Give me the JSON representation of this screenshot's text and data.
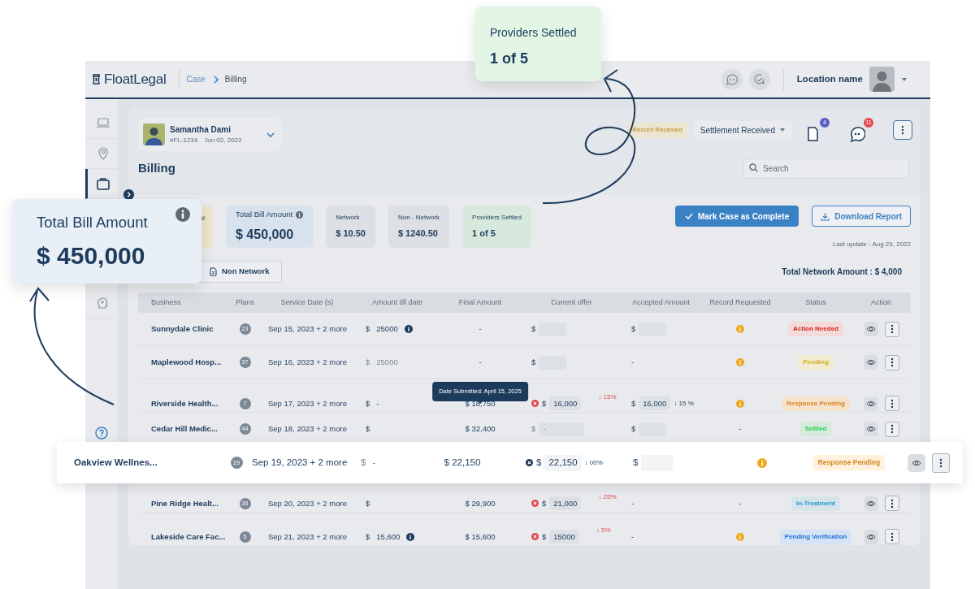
{
  "header": {
    "logo": "**Float**Legal",
    "breadcrumb": [
      {
        "label": "Case",
        "current": false
      },
      {
        "label": "Billing",
        "current": true
      }
    ],
    "location": "Location name"
  },
  "sidebar": {
    "items": [
      {
        "selected": false
      },
      {
        "selected": false
      },
      {
        "selected": true
      },
      {
        "selected": false
      }
    ]
  },
  "patient": {
    "name": "Samantha Dami",
    "case_id": "#FL-1234",
    "date": "Jun 02, 2022"
  },
  "record_status": "Record Received",
  "settlement_dropdown": "Settlement Received",
  "notifications": [
    {
      "count": "4",
      "color": "#5b5fc7"
    },
    {
      "count": "11",
      "color": "#e5484d"
    }
  ],
  "page_title": "Billing",
  "search": {
    "placeholder": "Search"
  },
  "stats": [
    {
      "label": "d",
      "color": "#efe5cc"
    },
    {
      "label": "Total Bill Amount",
      "value": "$ 450,000",
      "info": true,
      "color": "#d8e2ec"
    },
    {
      "label": "Network",
      "value": "$ 10.50",
      "color": "#dcdfe3"
    },
    {
      "label": "Non - Network",
      "value": "$ 1240.50",
      "color": "#dcdfe3"
    },
    {
      "label": "Providers Settled",
      "value": "1 of 5",
      "color": "#d6e9dc"
    }
  ],
  "actions": {
    "primary": "Mark Case as Complete",
    "secondary": "Download Report",
    "last_update": "Last update - Aug 29, 2022"
  },
  "tabs": [
    {
      "label": "Non Network",
      "selected": false
    }
  ],
  "total_network": "Total Network Amount : $ 4,000",
  "table": {
    "columns": [
      "Business",
      "Plans",
      "Service Date (s)",
      "Amount till date",
      "Final Amount",
      "Current offer",
      "Accepted Amount",
      "Record Requested",
      "Status",
      "Action"
    ],
    "rows": [
      {
        "business": "Sunnydale Clinic",
        "plans": "23",
        "service_date": "Sep 15, 2023 + 2 more",
        "amount": {
          "currency": "$",
          "value": "25000",
          "info": true,
          "muted": false
        },
        "final": "-",
        "offer": {
          "kind": "field",
          "currency": "$",
          "muted": false
        },
        "accepted": {
          "kind": "field",
          "currency": "$",
          "muted": false
        },
        "record": {
          "kind": "icon"
        },
        "status": {
          "text": "Action Needed",
          "color": "#f5dada"
        },
        "highlighted": false
      },
      {
        "business": "Maplewood Hosp...",
        "plans": "37",
        "service_date": "Sep 16, 2023 + 2 more",
        "amount": {
          "currency": "$",
          "value": "25000",
          "muted": true
        },
        "final": "-",
        "offer": {
          "kind": "field",
          "currency": "$",
          "muted": false
        },
        "accepted": {
          "kind": "text",
          "text": "-"
        },
        "record": {
          "kind": "icon"
        },
        "status": {
          "text": "Pending",
          "color": "#f3ecd0"
        },
        "highlighted": false
      },
      {
        "business": "Riverside Health...",
        "plans": "7",
        "service_date": "Sep 17, 2023 + 2 more",
        "amount": {
          "currency": "$",
          "value": "-",
          "muted": false
        },
        "final": "$ 18,750",
        "final_tooltip": "Date Submitted: April 15, 2025",
        "offer": {
          "kind": "field",
          "currency": "$",
          "value": "16,000",
          "change": "↓ 15%",
          "alert": true,
          "marker": {
            "color": "#e5484d"
          },
          "muted": false
        },
        "accepted": {
          "kind": "field",
          "currency": "$",
          "value": "16,000",
          "change": "↓ 15 %",
          "alert": false,
          "muted": false
        },
        "record": {
          "kind": "icon"
        },
        "status": {
          "text": "Response Pending",
          "color": "#f6e3cc"
        },
        "highlighted": false
      },
      {
        "business": "Cedar Hill Medic...",
        "plans": "44",
        "service_date": "Sep 18, 2023 + 2 more",
        "amount": {
          "currency": "$",
          "muted": false
        },
        "final": "$ 32,400",
        "offer": {
          "kind": "field",
          "currency": "$",
          "value": "-",
          "muted": true
        },
        "accepted": {
          "kind": "field",
          "currency": "$",
          "muted": false
        },
        "record": {
          "kind": "text",
          "text": "-"
        },
        "status": {
          "text": "Settled",
          "color": "#d5eadb"
        },
        "highlighted": false
      },
      {
        "business": "Oakview Wellnes...",
        "plans": "19",
        "service_date": "Sep 19, 2023 + 2 more",
        "amount": {
          "currency": "$",
          "value": "-",
          "muted": true
        },
        "final": "$ 22,150",
        "offer": {
          "kind": "field",
          "currency": "$",
          "value": "22,150",
          "change": "↓ 00%",
          "alert": false,
          "marker": {
            "color": "#1d3b5c"
          },
          "muted": false
        },
        "accepted": {
          "kind": "field",
          "currency": "$",
          "muted": false
        },
        "record": {
          "kind": "icon"
        },
        "status": {
          "text": "Response Pending",
          "color": "#fff1de"
        },
        "highlighted": true
      },
      {
        "business": "Pine Ridge Healt...",
        "plans": "36",
        "service_date": "Sep 20, 2023 + 2 more",
        "amount": {
          "currency": "$",
          "muted": false
        },
        "final": "$ 29,900",
        "offer": {
          "kind": "field",
          "currency": "$",
          "value": "21,000",
          "change": "↓ 25%",
          "alert": true,
          "marker": {
            "color": "#e5484d"
          },
          "muted": false
        },
        "accepted": {
          "kind": "text",
          "text": "-"
        },
        "record": {
          "kind": "text",
          "text": "-"
        },
        "status": {
          "text": "In-Treatment",
          "color": "#d7e4ea"
        },
        "highlighted": false
      },
      {
        "business": "Lakeside Care Fac...",
        "plans": "5",
        "service_date": "Sep 21, 2023 + 2 more",
        "amount": {
          "currency": "$",
          "value": "15,600",
          "info": true,
          "muted": false
        },
        "final": "$ 15,600",
        "offer": {
          "kind": "field",
          "currency": "$",
          "value": "15000",
          "change": "↓ 5%",
          "alert": true,
          "marker": {
            "color": "#e5484d"
          },
          "muted": false
        },
        "accepted": {
          "kind": "text",
          "text": "-"
        },
        "record": {
          "kind": "icon"
        },
        "status": {
          "text": "Pending Verification",
          "color": "#d5e3f5"
        },
        "highlighted": false
      }
    ]
  },
  "callouts": [
    {
      "label": "Providers Settled",
      "value": "1 of 5",
      "color": "#e3f6e6"
    },
    {
      "label": "Total Bill Amount",
      "value": "$ 450,000",
      "info": true,
      "color": "#e8eff7"
    }
  ]
}
